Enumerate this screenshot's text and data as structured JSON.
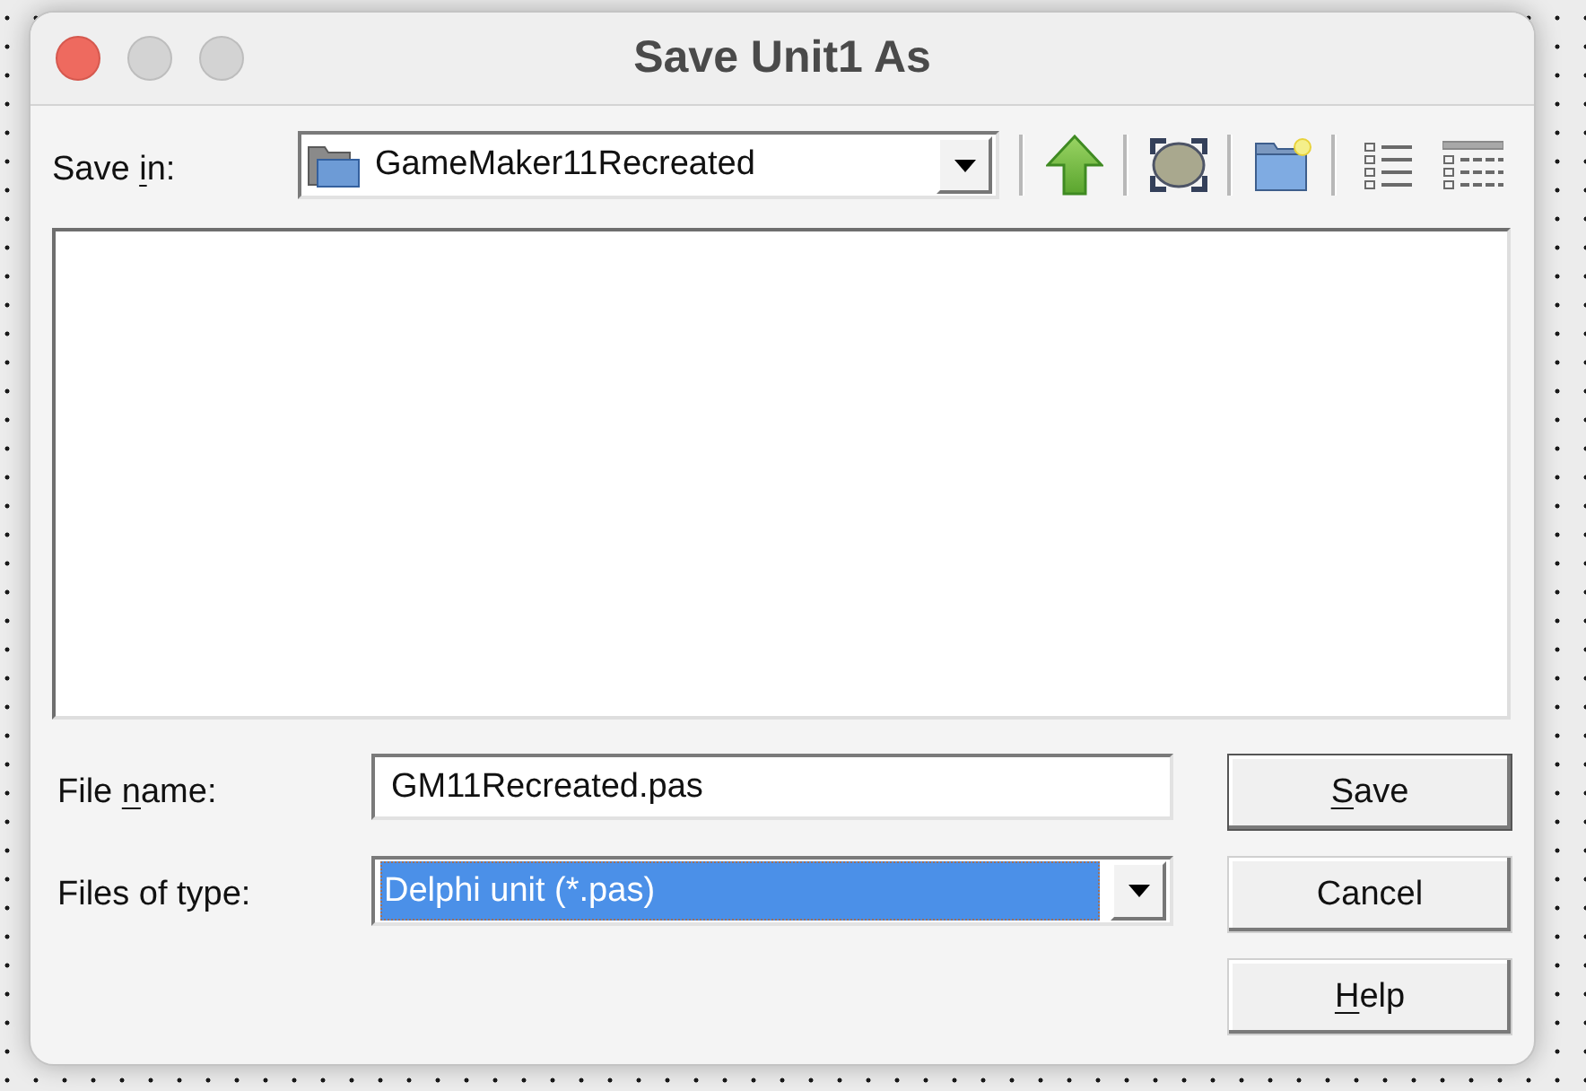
{
  "window": {
    "title": "Save Unit1 As",
    "controls": [
      {
        "kind": "close",
        "active": true
      },
      {
        "kind": "minimize",
        "active": false
      },
      {
        "kind": "zoom",
        "active": false
      }
    ]
  },
  "save_in": {
    "label": [
      {
        "text": "Save ",
        "underlined": false
      },
      {
        "text": "i",
        "underlined": true
      },
      {
        "text": "n:",
        "underlined": false
      }
    ],
    "value": "GameMaker11Recreated"
  },
  "file_name": {
    "label": [
      {
        "text": "File ",
        "underlined": false
      },
      {
        "text": "n",
        "underlined": true
      },
      {
        "text": "ame:",
        "underlined": false
      }
    ],
    "value": "GM11Recreated.pas"
  },
  "file_type": {
    "label": [
      {
        "text": "Files of type:",
        "underlined": false
      }
    ],
    "value": "Delphi unit (*.pas)",
    "focused": true
  },
  "buttons": [
    {
      "label": [
        {
          "text": "S",
          "underlined": true
        },
        {
          "text": "ave",
          "underlined": false
        }
      ],
      "default": true
    },
    {
      "label": [
        {
          "text": "Cancel",
          "underlined": false
        }
      ],
      "default": false
    },
    {
      "label": [
        {
          "text": "H",
          "underlined": true
        },
        {
          "text": "elp",
          "underlined": false
        }
      ],
      "default": false
    }
  ]
}
